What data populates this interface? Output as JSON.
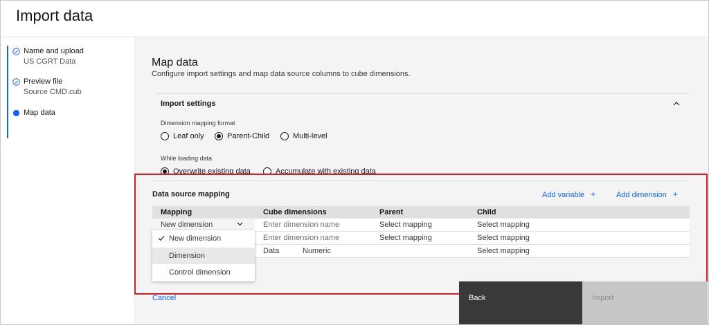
{
  "header": {
    "title": "Import data"
  },
  "steps": [
    {
      "label": "Name and upload",
      "sub": "US CGRT Data",
      "state": "complete"
    },
    {
      "label": "Preview file",
      "sub": "Source CMD.cub",
      "state": "complete"
    },
    {
      "label": "Map data",
      "state": "current"
    }
  ],
  "main": {
    "title": "Map data",
    "description": "Configure import settings and map data source columns to cube dimensions."
  },
  "import_settings": {
    "title": "Import settings",
    "format_label": "Dimension mapping format",
    "format_options": [
      "Leaf only",
      "Parent-Child",
      "Multi-level"
    ],
    "format_selected": "Parent-Child",
    "loading_label": "While loading data",
    "loading_options": [
      "Overwrite existing data",
      "Accumulate with existing data"
    ],
    "loading_selected": "Overwrite existing data"
  },
  "data_source_mapping": {
    "title": "Data source mapping",
    "add_variable": "Add variable",
    "add_dimension": "Add dimension",
    "columns": [
      "Mapping",
      "Cube dimensions",
      "Parent",
      "Child"
    ],
    "rows": [
      {
        "mapping": "New dimension",
        "cube": "Enter dimension name",
        "parent": "Select mapping",
        "child": "Select mapping"
      },
      {
        "mapping": "",
        "cube": "Enter dimension name",
        "parent": "Select mapping",
        "child": "Select mapping"
      },
      {
        "mapping": "",
        "cube": "Data",
        "cube_type": "Numeric",
        "parent": "",
        "child": "Select mapping"
      }
    ],
    "dropdown_options": [
      "New dimension",
      "Dimension",
      "Control dimension"
    ],
    "dropdown_selected": "New dimension",
    "dropdown_hovered": "Dimension"
  },
  "footer": {
    "cancel": "Cancel",
    "back": "Back",
    "import": "Import"
  },
  "colors": {
    "accent": "#0f62fe",
    "highlight_border": "#da1e28",
    "back_bg": "#393939",
    "import_bg": "#c6c6c6"
  },
  "icons": {
    "complete": "checkmark-outline-icon",
    "current": "radio-button-checked-icon",
    "collapse": "chevron-up-icon",
    "expand": "chevron-down-icon",
    "add": "plus-icon",
    "selected": "checkmark-icon"
  }
}
